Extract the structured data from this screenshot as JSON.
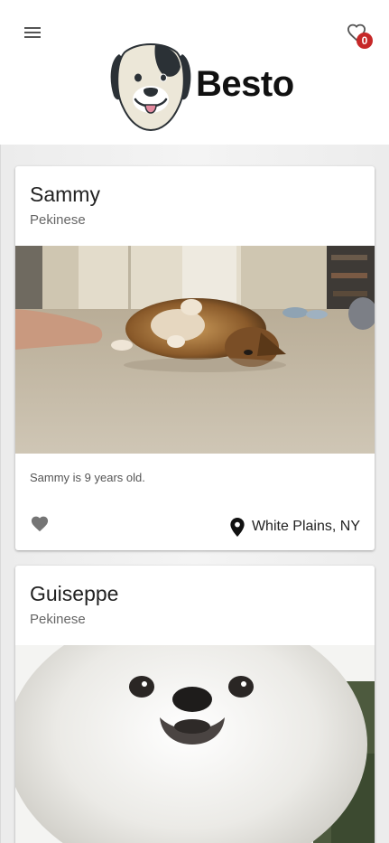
{
  "header": {
    "brand_name": "Besto",
    "favorites_count": "0",
    "menu_icon": "menu-icon",
    "favorites_icon": "heart-outline-icon"
  },
  "dogs": [
    {
      "name": "Sammy",
      "breed": "Pekinese",
      "description": "Sammy is 9 years old.",
      "location": "White Plains, NY",
      "favorite_icon": "heart-icon",
      "location_icon": "map-pin-icon",
      "photo": "photo of a small brown Pekinese lying on a carpet"
    },
    {
      "name": "Guiseppe",
      "breed": "Pekinese",
      "photo": "close-up photo of a fluffy white Pekinese"
    }
  ],
  "colors": {
    "badge": "#c62828",
    "icon_grey": "#757575",
    "page_background": "#efefef"
  }
}
